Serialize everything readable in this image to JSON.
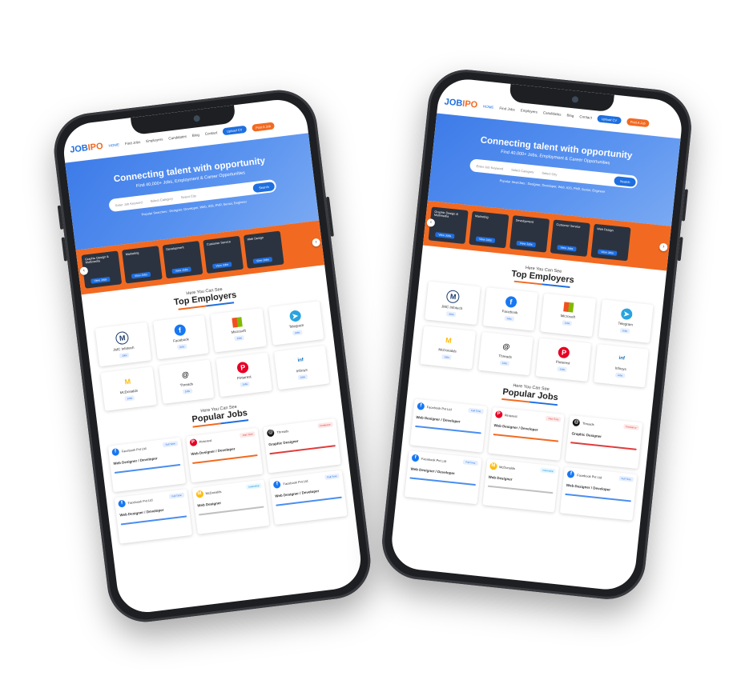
{
  "app": {
    "logo_main": "JOB",
    "logo_accent": "IPO",
    "nav": [
      "HOME",
      "Find Jobs",
      "Employers",
      "Candidates",
      "Blog",
      "Contact"
    ],
    "upload_cv": "Upload CV",
    "post_job": "Post A Job"
  },
  "hero": {
    "title": "Connecting talent with opportunity",
    "subtitle": "Find 40,000+ Jobs, Employment & Career Opportunities",
    "search_placeholder": "Enter Job Keyword",
    "select_category": "Select Category",
    "select_city": "Select City",
    "search_button": "Search",
    "popular": "Popular Searches : Designer, Developer, Web, IOS, PHP, Senior, Engineer"
  },
  "categories": [
    {
      "name": "Graphic Design & Multimedia",
      "button": "View Jobs"
    },
    {
      "name": "Marketing",
      "button": "View Jobs"
    },
    {
      "name": "Development",
      "button": "View Jobs"
    },
    {
      "name": "Customer Service",
      "button": "View Jobs"
    },
    {
      "name": "Web Design",
      "button": "View Jobs"
    }
  ],
  "top_employers": {
    "small": "Here You Can See",
    "title_bold": "Top",
    "title_rest": "Employers",
    "items": [
      {
        "name": "JMC Infotech",
        "icon": "jmc-icon",
        "tag": "Jobs"
      },
      {
        "name": "Facebook",
        "icon": "facebook-icon",
        "tag": "Jobs"
      },
      {
        "name": "Microsoft",
        "icon": "microsoft-icon",
        "tag": "Jobs"
      },
      {
        "name": "Telegram",
        "icon": "telegram-icon",
        "tag": "Jobs"
      },
      {
        "name": "McDonalds",
        "icon": "mcdonalds-icon",
        "tag": "Jobs"
      },
      {
        "name": "Threads",
        "icon": "threads-icon",
        "tag": "Jobs"
      },
      {
        "name": "Pinterest",
        "icon": "pinterest-icon",
        "tag": "Jobs"
      },
      {
        "name": "Infosys",
        "icon": "infosys-icon",
        "tag": "Jobs"
      }
    ]
  },
  "popular_jobs": {
    "small": "Here You Can See",
    "title_bold": "Popular",
    "title_rest": "Jobs",
    "items": [
      {
        "company": "Facebook Pvt Ltd",
        "title": "Web Designer / Developer",
        "badge": "Full Time",
        "color": "#1877f2",
        "bar": "#4a8ef0"
      },
      {
        "company": "Pinterest",
        "title": "Web Designer / Developer",
        "badge": "Part Time",
        "color": "#e60023",
        "bar": "#f26a21"
      },
      {
        "company": "Threads",
        "title": "Graphic Designer",
        "badge": "Freelance",
        "color": "#111111",
        "bar": "#e03c3c"
      },
      {
        "company": "Facebook Pvt Ltd",
        "title": "Web Designer / Developer",
        "badge": "Full Time",
        "color": "#1877f2",
        "bar": "#4a8ef0"
      },
      {
        "company": "McDonalds",
        "title": "Web Designer",
        "badge": "Internship",
        "color": "#ffbc0d",
        "bar": "#c0c0c0"
      },
      {
        "company": "Facebook Pvt Ltd",
        "title": "Web Designer / Developer",
        "badge": "Full Time",
        "color": "#1877f2",
        "bar": "#4a8ef0"
      }
    ]
  }
}
